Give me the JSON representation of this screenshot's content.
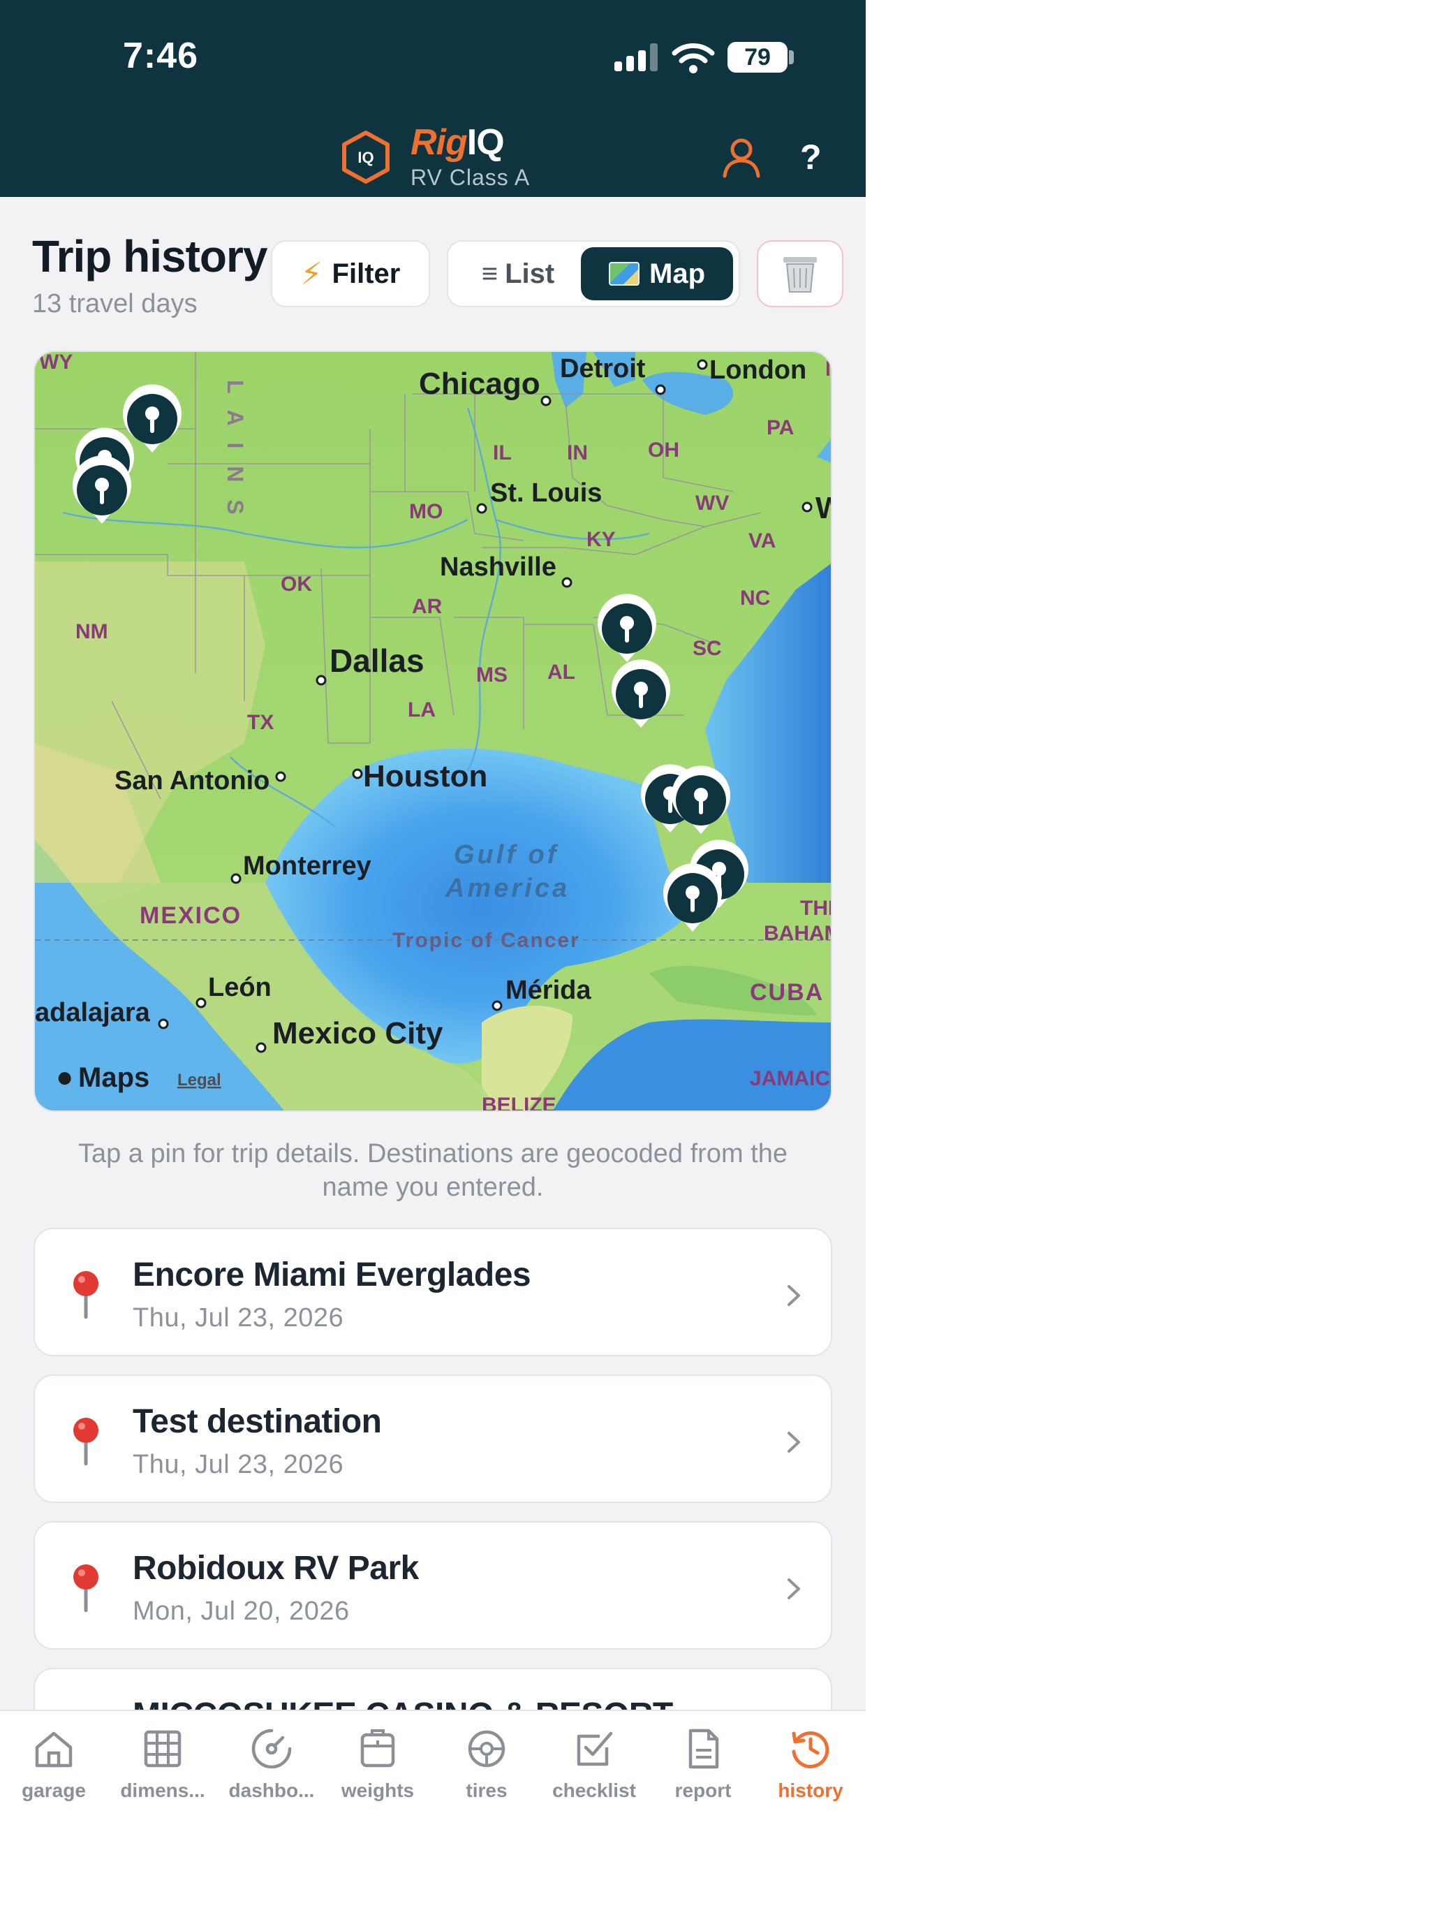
{
  "status_bar": {
    "time": "7:46",
    "battery": "79"
  },
  "header": {
    "logo_badge": "IQ",
    "brand_rig": "Rig",
    "brand_iq": "IQ",
    "subtitle": "RV Class A",
    "help_label": "?"
  },
  "page": {
    "title": "Trip history",
    "subtitle": "13 travel days",
    "filter_label": "Filter",
    "view_toggle": {
      "list_label": "List",
      "map_label": "Map",
      "selected": "Map"
    }
  },
  "map": {
    "labels": {
      "wy": "WY",
      "chicago": "Chicago",
      "detroit": "Detroit",
      "london": "London",
      "n": "N",
      "pa": "PA",
      "il": "IL",
      "in": "IN",
      "oh": "OH",
      "stlouis": "St. Louis",
      "wv": "WV",
      "w": "W",
      "mo": "MO",
      "ky": "KY",
      "va": "VA",
      "nashville": "Nashville",
      "ok": "OK",
      "ar": "AR",
      "nc": "NC",
      "nm": "NM",
      "sc": "SC",
      "dallas": "Dallas",
      "ms": "MS",
      "al": "AL",
      "la": "LA",
      "tx": "TX",
      "sanantonio": "San Antonio",
      "houston": "Houston",
      "gulf1": "Gulf of",
      "gulf2": "America",
      "monterrey": "Monterrey",
      "mexico": "MEXICO",
      "tropic": "Tropic of Cancer",
      "the": "THE",
      "baham": "BAHAM",
      "leon": "León",
      "merida": "Mérida",
      "cuba": "CUBA",
      "guadalajara": "adalajara",
      "mexicocity": "Mexico City",
      "jamaica": "JAMAIC",
      "belize": "BELIZE",
      "plains": "L A I N S",
      "maps": "Maps",
      "legal": "Legal"
    },
    "hint": "Tap a pin for trip details. Destinations are geocoded from the name you entered."
  },
  "trips": [
    {
      "name": "Encore Miami Everglades",
      "date": "Thu, Jul 23, 2026"
    },
    {
      "name": "Test destination",
      "date": "Thu, Jul 23, 2026"
    },
    {
      "name": "Robidoux RV Park",
      "date": "Mon, Jul 20, 2026"
    },
    {
      "name": "MICCOSUKEE CASINO & RESORT",
      "date": ""
    }
  ],
  "tabs": [
    {
      "label": "garage",
      "icon": "home-icon"
    },
    {
      "label": "dimens...",
      "icon": "grid-icon"
    },
    {
      "label": "dashbo...",
      "icon": "gauge-icon"
    },
    {
      "label": "weights",
      "icon": "weight-icon"
    },
    {
      "label": "tires",
      "icon": "tire-icon"
    },
    {
      "label": "checklist",
      "icon": "checkbox-icon"
    },
    {
      "label": "report",
      "icon": "document-icon"
    },
    {
      "label": "history",
      "icon": "history-icon",
      "active": true
    }
  ],
  "colors": {
    "navy": "#0e3440",
    "accent": "#f07030",
    "pin_red": "#e03a32"
  }
}
